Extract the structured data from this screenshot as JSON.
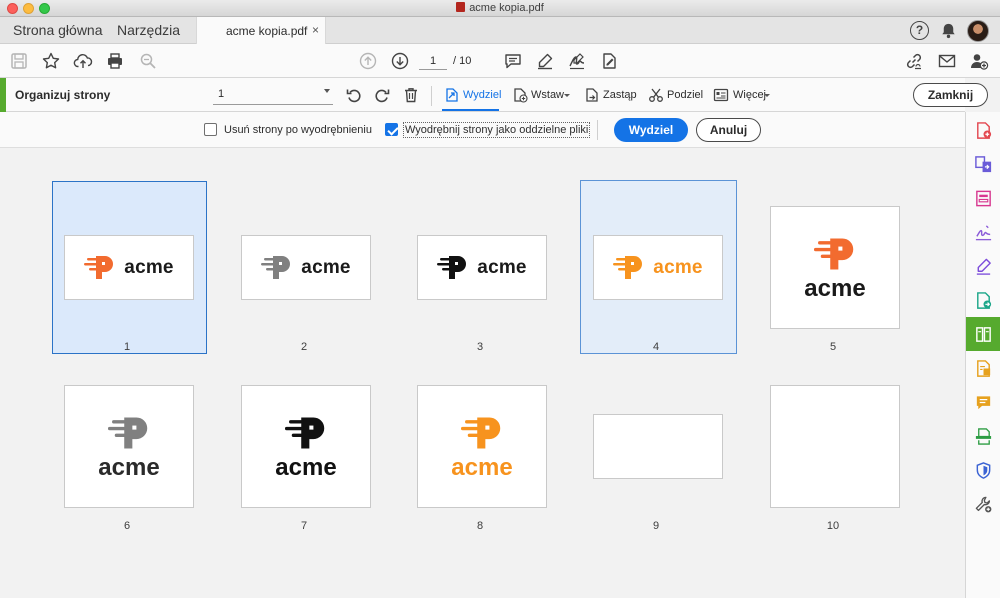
{
  "window": {
    "title": "acme kopia.pdf"
  },
  "topnav": {
    "home": "Strona główna",
    "tools": "Narzędzia"
  },
  "doc_tab": {
    "label": "acme kopia.pdf",
    "close": "×"
  },
  "header_icons": [
    "help-icon",
    "bell-icon",
    "avatar"
  ],
  "toolbar": {
    "icons": [
      "save-icon",
      "bookmark-star-icon",
      "upload-cloud-icon",
      "print-icon",
      "zoom-search-icon",
      "page-up-icon",
      "page-down-icon",
      "comment-icon",
      "highlight-pen-icon",
      "sign-icon",
      "fill-sign-icon",
      "share-link-icon",
      "email-icon",
      "add-user-icon"
    ],
    "current_page": "1",
    "total_pages": "/ 10"
  },
  "organize": {
    "title": "Organizuj strony",
    "range_value": "1",
    "buttons": {
      "extract": "Wydziel",
      "insert": "Wstaw",
      "replace": "Zastąp",
      "split": "Podziel",
      "more": "Więcej"
    },
    "close_label": "Zamknij"
  },
  "options": {
    "delete_after_extract": {
      "label": "Usuń strony po wyodrębnieniu",
      "checked": false
    },
    "extract_separate": {
      "label": "Wyodrębnij strony jako oddzielne pliki",
      "checked": true
    },
    "extract_button": "Wydziel",
    "cancel_button": "Anuluj"
  },
  "pages": [
    {
      "number": "1",
      "selected": true,
      "logo": "horizontal",
      "mark_color": "#f26b2f",
      "word_color": "#1a1a1a",
      "word": "acme"
    },
    {
      "number": "2",
      "selected": false,
      "logo": "horizontal",
      "mark_color": "#808080",
      "word_color": "#1a1a1a",
      "word": "acme"
    },
    {
      "number": "3",
      "selected": false,
      "logo": "horizontal",
      "mark_color": "#111111",
      "word_color": "#1a1a1a",
      "word": "acme"
    },
    {
      "number": "4",
      "selected": true,
      "logo": "horizontal",
      "mark_color": "#f7931e",
      "word_color": "#f7931e",
      "word": "acme"
    },
    {
      "number": "5",
      "selected": false,
      "logo": "vertical",
      "mark_color": "#f26b2f",
      "word_color": "#1a1a1a",
      "word": "acme"
    },
    {
      "number": "6",
      "selected": false,
      "logo": "vertical",
      "mark_color": "#808080",
      "word_color": "#2a2a2a",
      "word": "acme"
    },
    {
      "number": "7",
      "selected": false,
      "logo": "vertical",
      "mark_color": "#111111",
      "word_color": "#111111",
      "word": "acme"
    },
    {
      "number": "8",
      "selected": false,
      "logo": "vertical",
      "mark_color": "#f7931e",
      "word_color": "#f7931e",
      "word": "acme"
    },
    {
      "number": "9",
      "selected": false,
      "logo": "blank",
      "word": ""
    },
    {
      "number": "10",
      "selected": false,
      "logo": "blank",
      "word": ""
    }
  ],
  "right_rail": [
    {
      "icon": "create-pdf-icon",
      "color": "#e34850"
    },
    {
      "icon": "combine-files-icon",
      "color": "#6a5bd8"
    },
    {
      "icon": "prepare-form-icon",
      "color": "#d83790"
    },
    {
      "icon": "fill-and-sign-icon",
      "color": "#8b5bd8"
    },
    {
      "icon": "request-signature-icon",
      "color": "#7d4cdb"
    },
    {
      "icon": "export-pdf-icon",
      "color": "#1ba689"
    },
    {
      "icon": "organize-pages-icon",
      "color": "#ffffff",
      "active": true
    },
    {
      "icon": "edit-pdf-icon",
      "color": "#e6a11e"
    },
    {
      "icon": "comment-tool-icon",
      "color": "#e6a11e"
    },
    {
      "icon": "scan-ocr-icon",
      "color": "#2d9d43"
    },
    {
      "icon": "protect-icon",
      "color": "#3b63d4"
    },
    {
      "icon": "more-tools-icon",
      "color": "#555555"
    }
  ],
  "colors": {
    "accent": "#1473e6",
    "organize_green": "#56aa2e",
    "selection_fill": "#dbe9fb"
  }
}
